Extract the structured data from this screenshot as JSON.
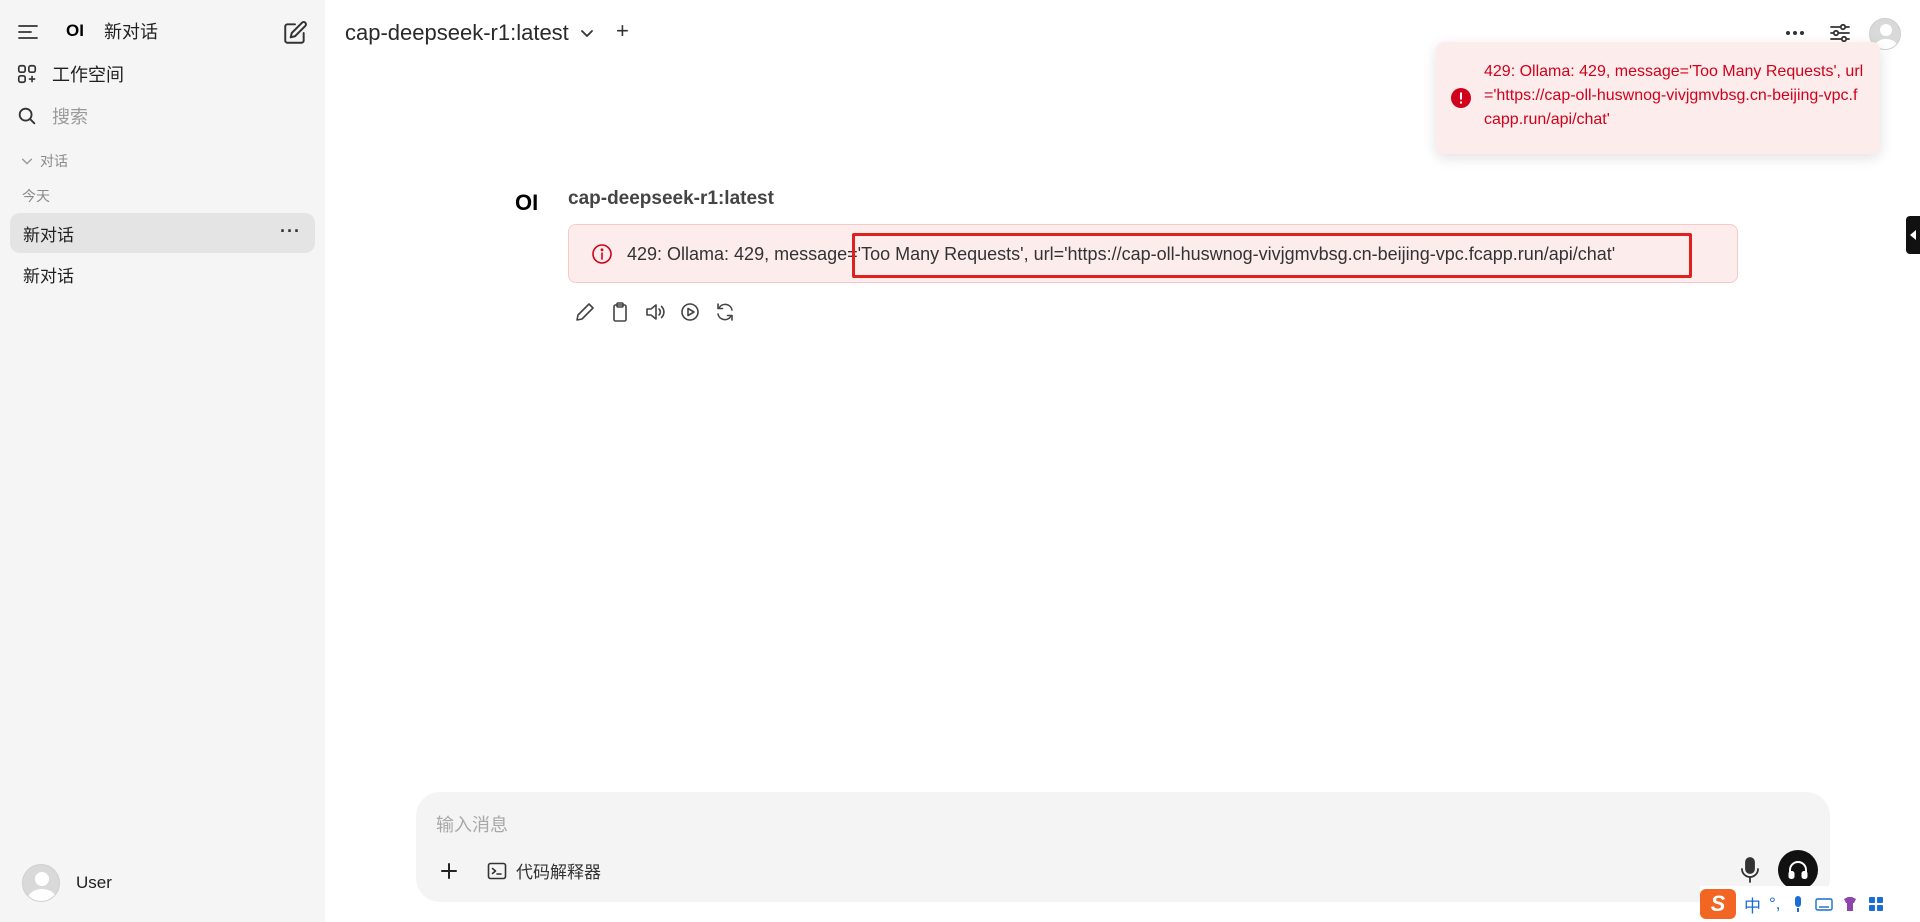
{
  "sidebar": {
    "app_title": "新对话",
    "logo_text": "OI",
    "workspace_label": "工作空间",
    "search_placeholder": "搜索",
    "folder_label": "对话",
    "group_label": "今天",
    "chats": [
      {
        "title": "新对话",
        "more": "···"
      },
      {
        "title": "新对话"
      }
    ],
    "user_name": "User"
  },
  "header": {
    "model_name": "cap-deepseek-r1:latest",
    "add_label": "+"
  },
  "toast": {
    "message": "429: Ollama: 429, message='Too Many Requests', url='https://cap-oll-huswnog-vivjgmvbsg.cn-beijing-vpc.fcapp.run/api/chat'"
  },
  "message": {
    "logo_text": "OI",
    "model_name": "cap-deepseek-r1:latest",
    "error_text": "429: Ollama: 429, message='Too Many Requests', url='https://cap-oll-huswnog-vivjgmvbsg.cn-beijing-vpc.fcapp.run/api/chat'"
  },
  "input": {
    "placeholder": "输入消息",
    "code_interpreter_label": "代码解释器"
  },
  "ime": {
    "logo": "S",
    "lang": "中",
    "punct": "°,"
  },
  "colors": {
    "error_red": "#d0021b",
    "error_bg": "#fdecec",
    "highlight_border": "#e0201c",
    "sidebar_bg": "#f5f5f5"
  }
}
